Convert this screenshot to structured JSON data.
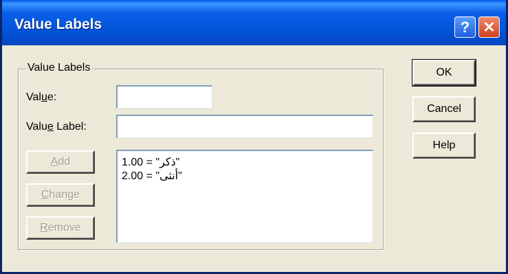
{
  "window": {
    "title": "Value Labels"
  },
  "titlebar_buttons": {
    "help": "?",
    "close": "✕"
  },
  "group": {
    "label": "Value Labels"
  },
  "value": {
    "label_pre": "Val",
    "label_mnemonic": "u",
    "label_post": "e:",
    "current": ""
  },
  "value_label": {
    "label_pre": "Valu",
    "label_mnemonic": "e",
    "label_post": " Label:",
    "current": ""
  },
  "list": {
    "items": [
      "1.00 = \"ذكر\"",
      "2.00 = \"أنثى\""
    ]
  },
  "buttons": {
    "add": {
      "mnemonic": "A",
      "rest": "dd"
    },
    "change": {
      "mnemonic": "C",
      "rest": "hange"
    },
    "remove": {
      "mnemonic": "R",
      "rest": "emove"
    },
    "ok": "OK",
    "cancel": "Cancel",
    "help": "Help"
  }
}
